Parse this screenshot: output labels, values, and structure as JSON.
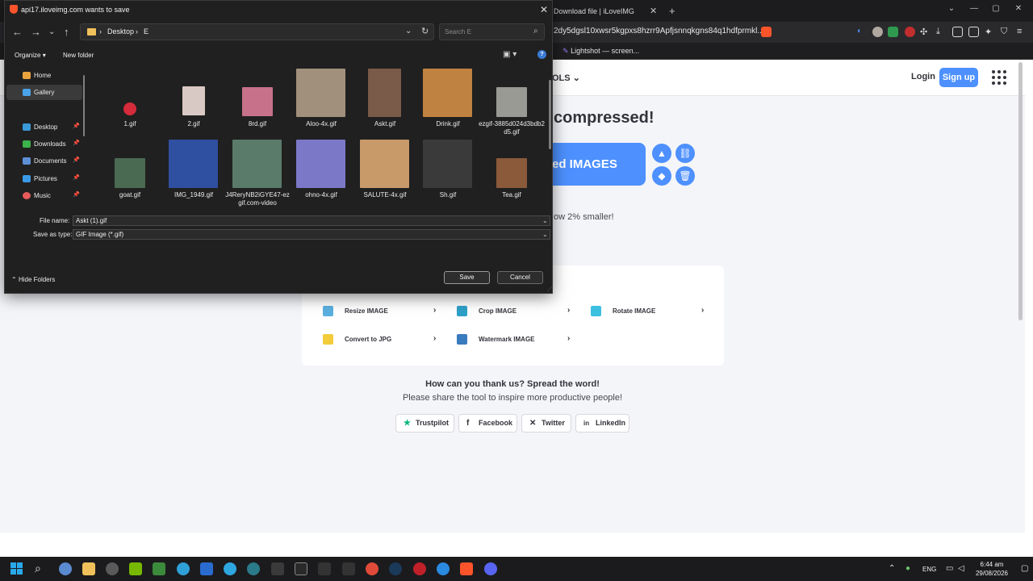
{
  "browser": {
    "tab_title": "Download file | iLoveIMG",
    "url": "2dy5dgsl10xwsr5kgpxs8hzrr9Apfjsnnqkgns84q1hdfprmkl...",
    "bookmark": "Lightshot — screen...",
    "new_tab": "+"
  },
  "site": {
    "tools_menu": "OLS",
    "login": "Login",
    "signup": "Sign up",
    "headline": "compressed!",
    "download_label": "ed IMAGES",
    "smaller_text": "ow 2% smaller!",
    "tools": [
      {
        "label": "Resize IMAGE",
        "color": "#5bb0e0"
      },
      {
        "label": "Crop IMAGE",
        "color": "#2ea0c8"
      },
      {
        "label": "Rotate IMAGE",
        "color": "#3cc0e0"
      },
      {
        "label": "Convert to JPG",
        "color": "#f2cc3a"
      },
      {
        "label": "Watermark IMAGE",
        "color": "#3a7bbd"
      }
    ],
    "thanks_title": "How can you thank us? Spread the word!",
    "thanks_sub": "Please share the tool to inspire more productive people!",
    "share": [
      {
        "label": "Trustpilot",
        "icon": "★"
      },
      {
        "label": "Facebook",
        "icon": "f"
      },
      {
        "label": "Twitter",
        "icon": "✕"
      },
      {
        "label": "LinkedIn",
        "icon": "in"
      }
    ]
  },
  "dialog": {
    "title": "api17.iloveimg.com wants to save",
    "path": [
      "Desktop",
      "E"
    ],
    "search_placeholder": "Search E",
    "organize": "Organize",
    "new_folder": "New folder",
    "nav": [
      {
        "label": "Home",
        "color": "#e8a33d"
      },
      {
        "label": "Gallery",
        "color": "#4aa3e8"
      },
      {
        "label": "Desktop",
        "color": "#3a9ad9"
      },
      {
        "label": "Downloads",
        "color": "#3bb24a"
      },
      {
        "label": "Documents",
        "color": "#5d8fd6"
      },
      {
        "label": "Pictures",
        "color": "#3b9ae6"
      },
      {
        "label": "Music",
        "color": "#e85a5a"
      }
    ],
    "files": [
      {
        "name": "1.gif",
        "color": "#d62b3a"
      },
      {
        "name": "2.gif",
        "color": "#d9c9c4"
      },
      {
        "name": "8rd.gif",
        "color": "#c7728a"
      },
      {
        "name": "Aloo-4x.gif",
        "color": "#a0907c"
      },
      {
        "name": "Askt.gif",
        "color": "#7a5a48"
      },
      {
        "name": "Drink.gif",
        "color": "#c08240"
      },
      {
        "name": "ezgif-3885d024d3bdb2d5.gif",
        "color": "#9a9a94"
      },
      {
        "name": "goat.gif",
        "color": "#4a6a52"
      },
      {
        "name": "IMG_1949.gif",
        "color": "#2f4fa0"
      },
      {
        "name": "J4ReryNB2iGYE47-ezgif.com-video",
        "color": "#5a7a6a"
      },
      {
        "name": "ohno-4x.gif",
        "color": "#7c78c8"
      },
      {
        "name": "SALUTE-4x.gif",
        "color": "#c89a6a"
      },
      {
        "name": "Sh.gif",
        "color": "#3a3a3a"
      },
      {
        "name": "Tea.gif",
        "color": "#8a5a3a"
      }
    ],
    "file_name_label": "File name:",
    "file_name_value": "Askt (1).gif",
    "save_type_label": "Save as type:",
    "save_type_value": "GIF Image (*.gif)",
    "hide_folders": "Hide Folders",
    "save": "Save",
    "cancel": "Cancel"
  },
  "taskbar": {
    "lang": "ENG",
    "time": "6:44 am",
    "date": "29/08/2026"
  }
}
